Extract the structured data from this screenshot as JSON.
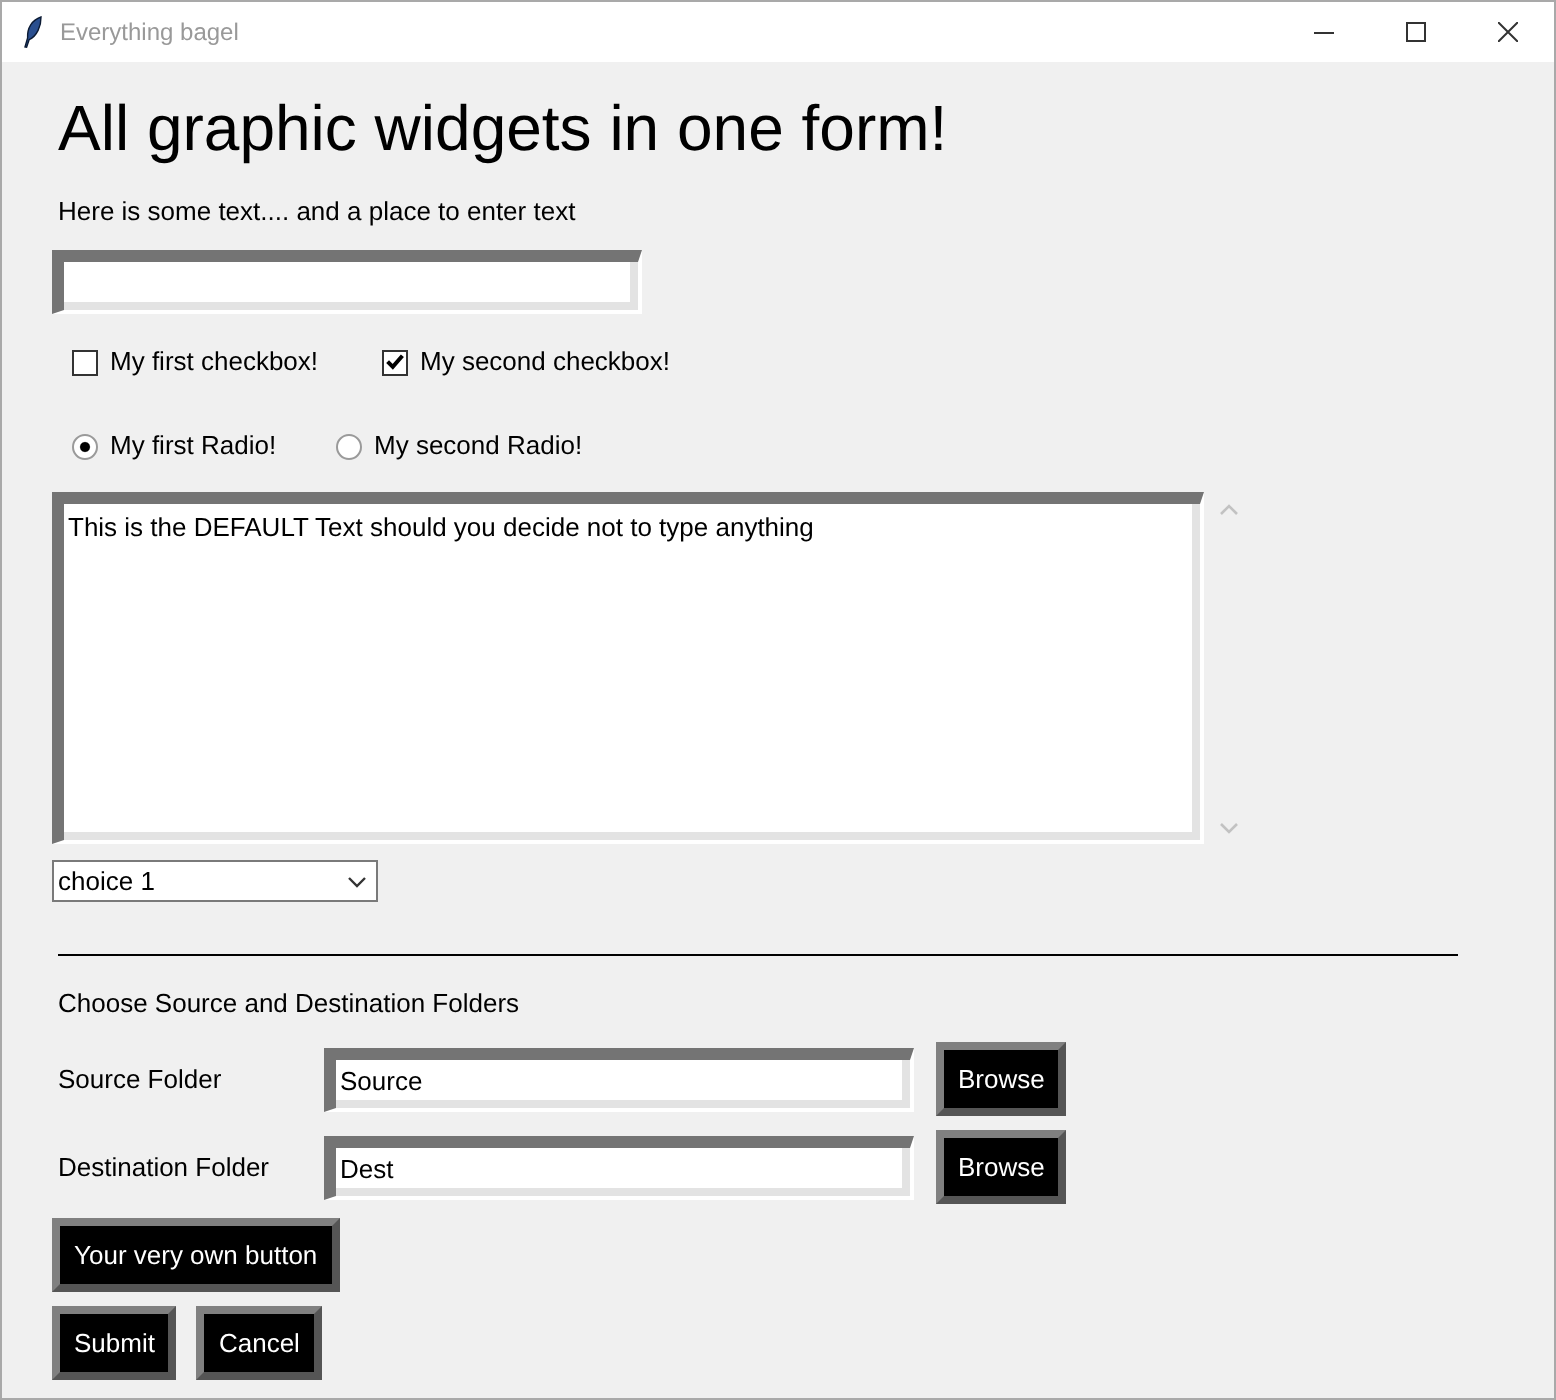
{
  "window": {
    "title": "Everything bagel"
  },
  "heading": "All graphic widgets in one form!",
  "intro": "Here is some text.... and a place to enter text",
  "checkboxes": [
    {
      "label": "My first checkbox!",
      "checked": false
    },
    {
      "label": "My second checkbox!",
      "checked": true
    }
  ],
  "radios": [
    {
      "label": "My first Radio!",
      "selected": true
    },
    {
      "label": "My second Radio!",
      "selected": false
    }
  ],
  "multiline": {
    "value": "This is the DEFAULT Text should you decide not to type anything"
  },
  "combo": {
    "value": "choice 1"
  },
  "folders": {
    "heading": "Choose Source and Destination Folders",
    "rows": [
      {
        "label": "Source Folder",
        "value": "Source",
        "button": "Browse"
      },
      {
        "label": "Destination Folder",
        "value": "Dest",
        "button": "Browse"
      }
    ]
  },
  "custom_button": "Your very own button",
  "buttons": [
    "Submit",
    "Cancel"
  ]
}
